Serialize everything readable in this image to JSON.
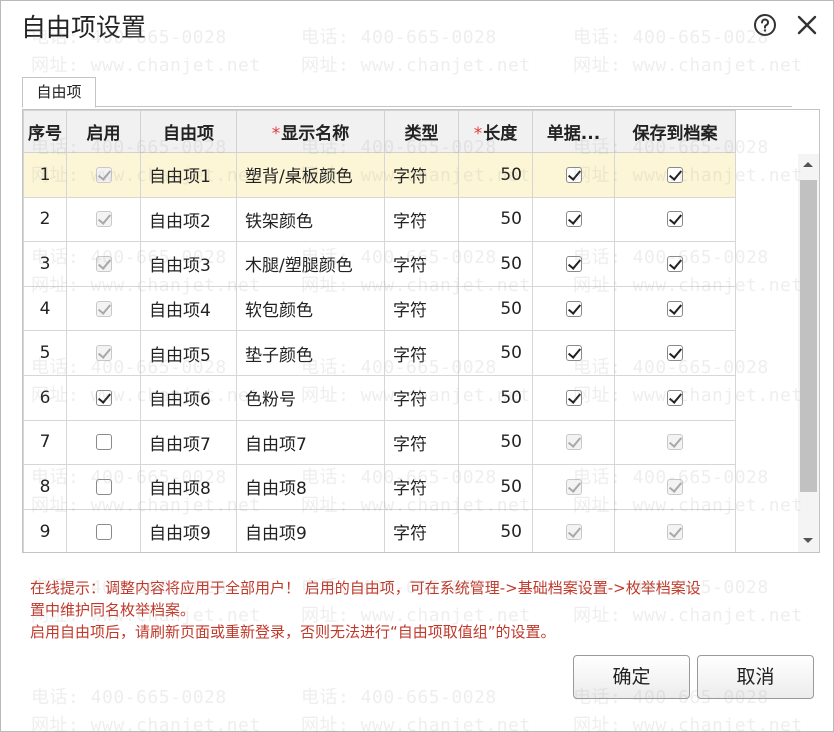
{
  "dialog": {
    "title": "自由项设置",
    "help_icon": "question-circle-icon",
    "close_icon": "close-icon"
  },
  "tabs": [
    {
      "label": "自由项",
      "active": true
    }
  ],
  "table": {
    "headers": {
      "no": "序号",
      "enable": "启用",
      "item": "自由项",
      "display_name": "显示名称",
      "type": "类型",
      "length": "长度",
      "doc": "单据...",
      "save": "保存到档案"
    },
    "required_mark": "*",
    "rows": [
      {
        "no": "1",
        "enable": "disabled-checked",
        "item": "自由项1",
        "display": "塑背/桌板颜色",
        "type": "字符",
        "length": "50",
        "doc": "checked",
        "save": "checked",
        "selected": true
      },
      {
        "no": "2",
        "enable": "disabled-checked",
        "item": "自由项2",
        "display": "铁架颜色",
        "type": "字符",
        "length": "50",
        "doc": "checked",
        "save": "checked"
      },
      {
        "no": "3",
        "enable": "disabled-checked",
        "item": "自由项3",
        "display": "木腿/塑腿颜色",
        "type": "字符",
        "length": "50",
        "doc": "checked",
        "save": "checked"
      },
      {
        "no": "4",
        "enable": "disabled-checked",
        "item": "自由项4",
        "display": "软包颜色",
        "type": "字符",
        "length": "50",
        "doc": "checked",
        "save": "checked"
      },
      {
        "no": "5",
        "enable": "disabled-checked",
        "item": "自由项5",
        "display": "垫子颜色",
        "type": "字符",
        "length": "50",
        "doc": "checked",
        "save": "checked"
      },
      {
        "no": "6",
        "enable": "checked",
        "item": "自由项6",
        "display": "色粉号",
        "type": "字符",
        "length": "50",
        "doc": "checked",
        "save": "checked"
      },
      {
        "no": "7",
        "enable": "unchecked",
        "item": "自由项7",
        "display": "自由项7",
        "type": "字符",
        "length": "50",
        "doc": "disabled-checked",
        "save": "disabled-checked"
      },
      {
        "no": "8",
        "enable": "unchecked",
        "item": "自由项8",
        "display": "自由项8",
        "type": "字符",
        "length": "50",
        "doc": "disabled-checked",
        "save": "disabled-checked"
      },
      {
        "no": "9",
        "enable": "unchecked",
        "item": "自由项9",
        "display": "自由项9",
        "type": "字符",
        "length": "50",
        "doc": "disabled-checked",
        "save": "disabled-checked"
      }
    ]
  },
  "hint": {
    "line1": "在线提示：调整内容将应用于全部用户！ 启用的自由项，可在系统管理->基础档案设置->枚举档案设",
    "line2": "置中维护同名枚举档案。",
    "line3": "启用自由项后，请刷新页面或重新登录，否则无法进行“自由项取值组”的设置。"
  },
  "buttons": {
    "ok": "确定",
    "cancel": "取消"
  },
  "watermark": {
    "phone": "电话: 400-665-0028",
    "site": "网址: www.chanjet.net"
  },
  "colors": {
    "hint": "#c0392b",
    "selected_row": "#fdf6d6",
    "required": "#e23b3b"
  }
}
